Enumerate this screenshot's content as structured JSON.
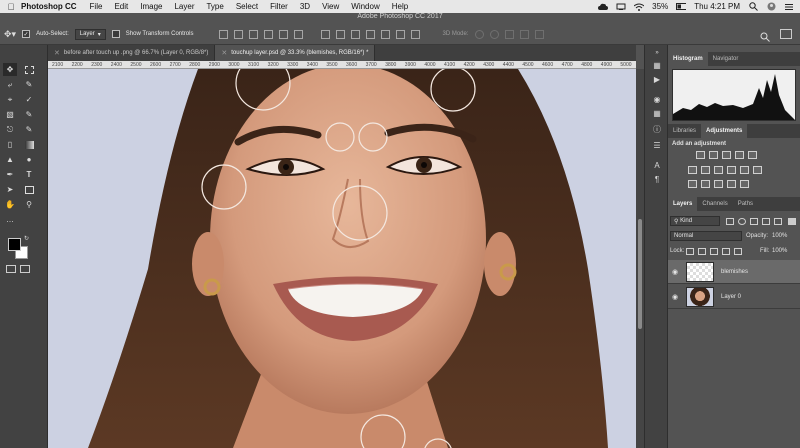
{
  "menubar": {
    "app_name": "Photoshop CC",
    "items": [
      "File",
      "Edit",
      "Image",
      "Layer",
      "Type",
      "Select",
      "Filter",
      "3D",
      "View",
      "Window",
      "Help"
    ],
    "battery": "35%",
    "clock": "Thu 4:21 PM"
  },
  "window_title": "Adobe Photoshop CC 2017",
  "options_bar": {
    "auto_select_label": "Auto-Select:",
    "auto_select_value": "Layer",
    "show_transform_label": "Show Transform Controls",
    "mode_3d_label": "3D Mode:"
  },
  "tabs": [
    {
      "label": "before after touch up .png @ 66.7% (Layer 0, RGB/8*)"
    },
    {
      "label": "touchup layer.psd @ 33.3% (blemishes, RGB/16*) *"
    }
  ],
  "ruler_ticks": [
    "2100",
    "2200",
    "2300",
    "2400",
    "2500",
    "2600",
    "2700",
    "2800",
    "2900",
    "3000",
    "3100",
    "3200",
    "3300",
    "3400",
    "3500",
    "3600",
    "3700",
    "3800",
    "3900",
    "4000",
    "4100",
    "4200",
    "4300",
    "4400",
    "4500",
    "4600",
    "4700",
    "4800",
    "4900",
    "5000"
  ],
  "panels": {
    "top_tabs": [
      "Histogram",
      "Navigator"
    ],
    "mid_tabs": [
      "Libraries",
      "Adjustments"
    ],
    "add_adjustment": "Add an adjustment",
    "layer_tabs": [
      "Layers",
      "Channels",
      "Paths"
    ],
    "kind_label": "Kind",
    "blend_mode": "Normal",
    "opacity_label": "Opacity:",
    "opacity_value": "100%",
    "lock_label": "Lock:",
    "fill_label": "Fill:",
    "fill_value": "100%",
    "layers": [
      {
        "name": "blemishes",
        "selected": true
      },
      {
        "name": "Layer 0",
        "selected": false
      }
    ]
  }
}
